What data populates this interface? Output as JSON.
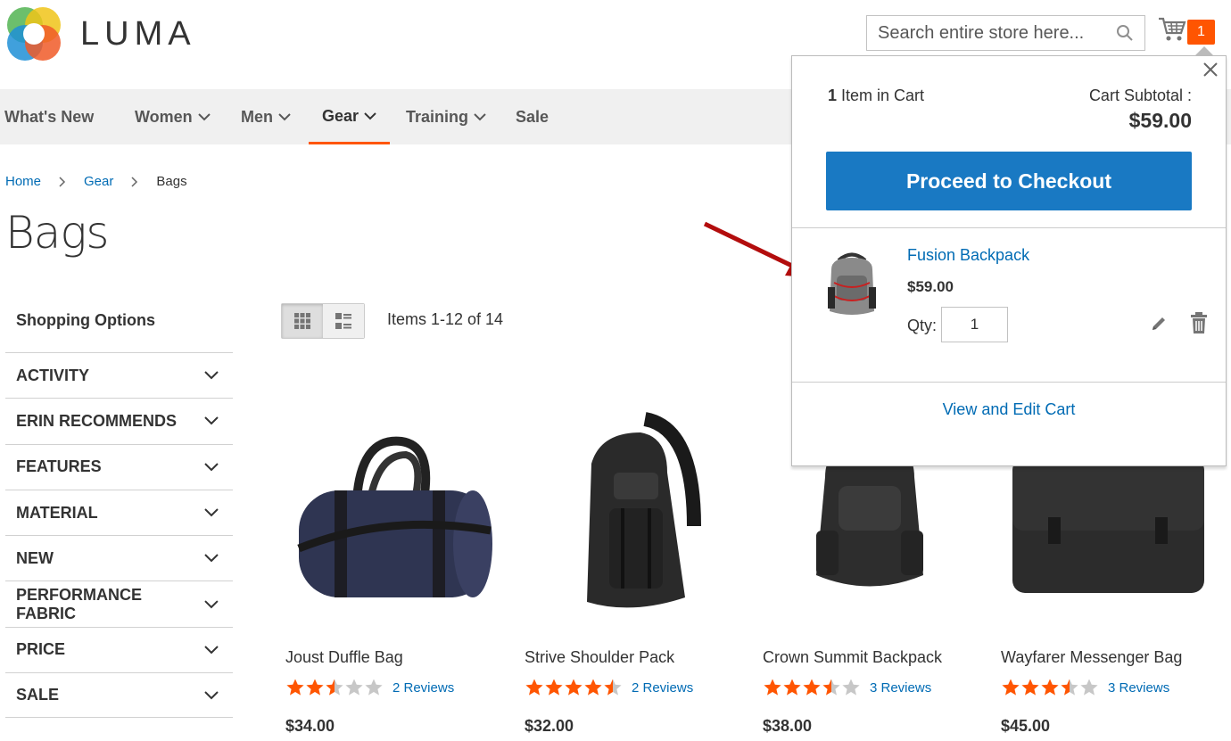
{
  "header": {
    "logo_text": "LUMA",
    "search_placeholder": "Search entire store here...",
    "cart_count": "1"
  },
  "nav": {
    "items": [
      {
        "label": "What's New"
      },
      {
        "label": "Women"
      },
      {
        "label": "Men"
      },
      {
        "label": "Gear"
      },
      {
        "label": "Training"
      },
      {
        "label": "Sale"
      }
    ]
  },
  "breadcrumb": {
    "items": [
      "Home",
      "Gear",
      "Bags"
    ]
  },
  "page": {
    "title": "Bags"
  },
  "sidebar": {
    "title": "Shopping Options",
    "filters": [
      "Activity",
      "Erin Recommends",
      "Features",
      "Material",
      "New",
      "Performance Fabric",
      "Price",
      "Sale"
    ]
  },
  "toolbar": {
    "items_count": "Items 1-12 of 14"
  },
  "products": [
    {
      "name": "Joust Duffle Bag",
      "rating": 2.5,
      "reviews": "2  Reviews",
      "price": "$34.00"
    },
    {
      "name": "Strive Shoulder Pack",
      "rating": 4.5,
      "reviews": "2  Reviews",
      "price": "$32.00"
    },
    {
      "name": "Crown Summit Backpack",
      "rating": 3.5,
      "reviews": "3  Reviews",
      "price": "$38.00"
    },
    {
      "name": "Wayfarer Messenger Bag",
      "rating": 3.5,
      "reviews": "3  Reviews",
      "price": "$45.00"
    }
  ],
  "minicart": {
    "count_number": "1",
    "count_text": " Item in Cart",
    "subtotal_label": "Cart Subtotal :",
    "subtotal": "$59.00",
    "checkout_label": "Proceed to Checkout",
    "item": {
      "name": "Fusion Backpack",
      "price": "$59.00",
      "qty_label": "Qty:",
      "qty": "1"
    },
    "view_edit_label": "View and Edit Cart"
  },
  "colors": {
    "accent_orange": "#ff5501",
    "link_blue": "#006bb4",
    "button_blue": "#1979c3",
    "star": "#ff5501",
    "star_empty": "#c7c7c7"
  }
}
